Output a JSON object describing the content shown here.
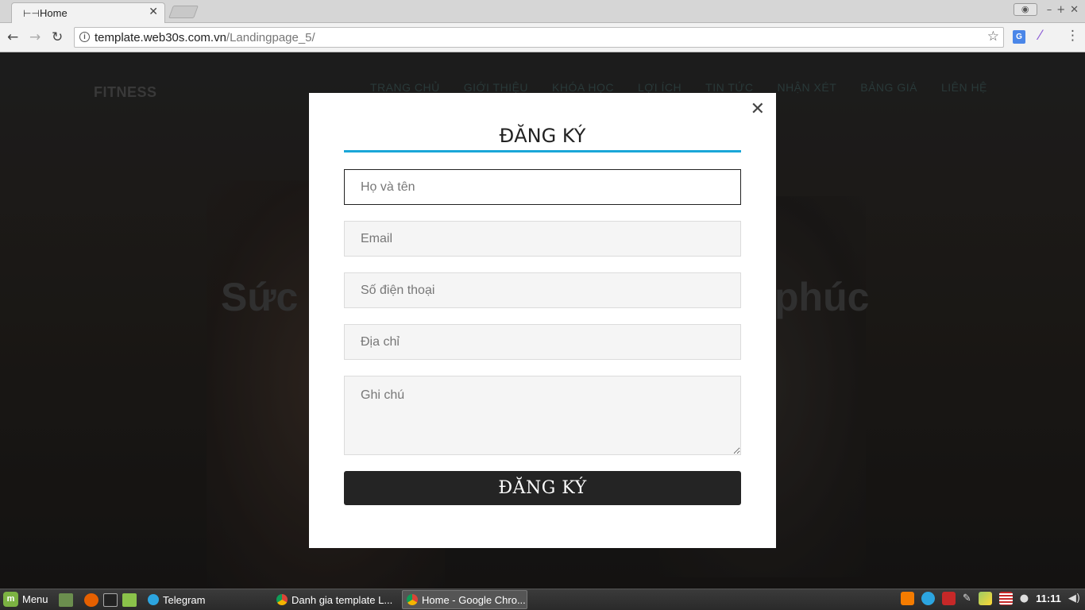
{
  "browser": {
    "tab_title": "Home",
    "tab_icon": "dumbbell-icon",
    "url_host": "template.web30s.com.vn",
    "url_path": "/Landingpage_5/"
  },
  "site": {
    "logo": "FITNESS",
    "nav": [
      "TRANG CHỦ",
      "GIỚI THIỆU",
      "KHÓA HỌC",
      "LỢI ÍCH",
      "TIN TỨC",
      "NHẬN XÉT",
      "BẢNG GIÁ",
      "LIÊN HỆ"
    ],
    "hero_left": "Sức k",
    "hero_right": "phúc"
  },
  "modal": {
    "title": "ĐĂNG KÝ",
    "fields": {
      "name_placeholder": "Họ và tên",
      "email_placeholder": "Email",
      "phone_placeholder": "Số điện thoại",
      "address_placeholder": "Địa chỉ",
      "note_placeholder": "Ghi chú"
    },
    "submit_label": "ĐĂNG KÝ",
    "accent_color": "#1aa6d8"
  },
  "taskbar": {
    "menu_label": "Menu",
    "tasks": [
      {
        "label": "Telegram"
      },
      {
        "label": "Danh gia template L..."
      },
      {
        "label": "Home - Google Chro..."
      }
    ],
    "clock": "11:11"
  }
}
